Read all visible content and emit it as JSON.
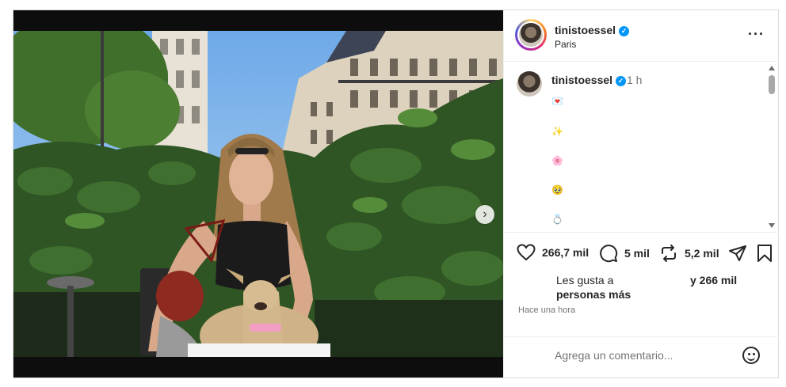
{
  "post": {
    "username": "tinistoessel",
    "location": "Paris",
    "more_label": "···",
    "time": "1 h",
    "caption_lines": [
      "💌",
      "✨",
      "🌸",
      "🥹",
      "💍"
    ],
    "carousel": {
      "dot_count": 6,
      "active_index": 0,
      "next_label": "›"
    },
    "likes_count": "266,7 mil",
    "comments_count": "5 mil",
    "reposts_count": "5,2 mil",
    "liked_by_text_1": "Les gusta a",
    "liked_by_text_2": "personas más",
    "liked_by_text_3": "y 266 mil",
    "time_ago": "Hace una hora",
    "comment_placeholder": "Agrega un comentario..."
  },
  "icons": {
    "verified": "verified-badge-icon",
    "like": "heart-icon",
    "comment": "comment-bubble-icon",
    "repost": "repost-icon",
    "share": "paper-plane-icon",
    "save": "bookmark-icon",
    "emoji": "smiley-icon"
  },
  "colors": {
    "verified": "#0095f6",
    "muted": "#737373",
    "text": "#262626"
  }
}
